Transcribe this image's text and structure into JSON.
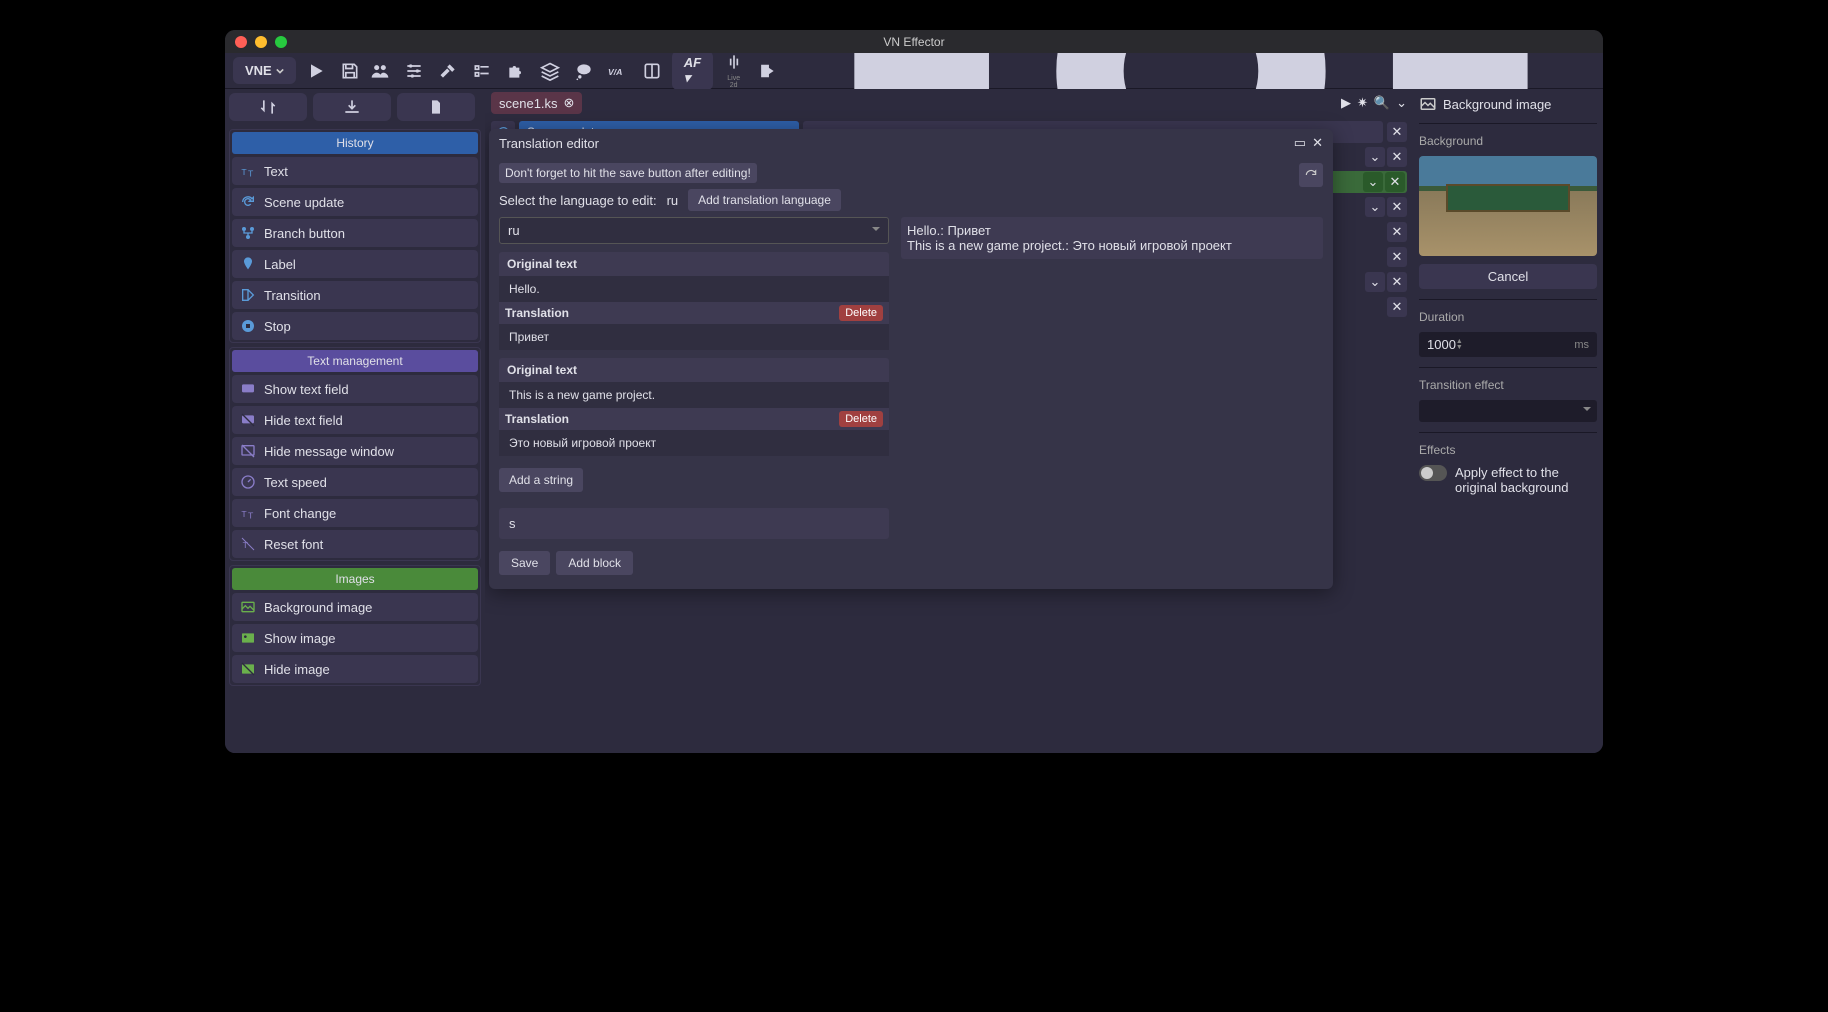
{
  "app": {
    "title": "VN Effector",
    "vne_menu": "VNE",
    "af_button": "AF",
    "live2d": "Live 2d"
  },
  "tabs": {
    "scene": "scene1.ks"
  },
  "sidebar": {
    "history": {
      "title": "History",
      "items": [
        "Text",
        "Scene update",
        "Branch button",
        "Label",
        "Transition",
        "Stop"
      ]
    },
    "text_mgmt": {
      "title": "Text management",
      "items": [
        "Show text field",
        "Hide text field",
        "Hide message window",
        "Text speed",
        "Font change",
        "Reset font"
      ]
    },
    "images": {
      "title": "Images",
      "items": [
        "Background image",
        "Show image",
        "Hide image"
      ]
    }
  },
  "timeline": {
    "rows": [
      {
        "label": "Scene update",
        "color": "blue"
      }
    ]
  },
  "modal": {
    "title": "Translation editor",
    "hint": "Don't forget to hit the save button after editing!",
    "select_label": "Select the language to edit:",
    "current_lang": "ru",
    "add_lang": "Add translation language",
    "dropdown_value": "ru",
    "preview": [
      "Hello.: Привет",
      "This is a new game project.: Это новый игровой проект"
    ],
    "blocks": [
      {
        "orig_label": "Original text",
        "orig": "Hello.",
        "trans_label": "Translation",
        "trans": "Привет",
        "delete": "Delete"
      },
      {
        "orig_label": "Original text",
        "orig": "This is a new game project.",
        "trans_label": "Translation",
        "trans": "Это новый игровой проект",
        "delete": "Delete"
      }
    ],
    "add_string": "Add a string",
    "search_value": "s",
    "save": "Save",
    "add_block": "Add block"
  },
  "inspector": {
    "title": "Background image",
    "bg_label": "Background",
    "cancel": "Cancel",
    "duration_label": "Duration",
    "duration_value": "1000",
    "duration_unit": "ms",
    "transition_label": "Transition effect",
    "effects_label": "Effects",
    "apply_label": "Apply effect to the original background"
  }
}
